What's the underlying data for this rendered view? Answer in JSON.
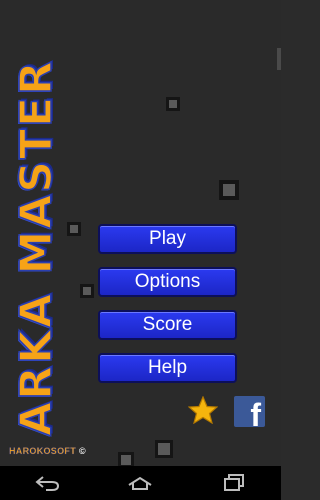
{
  "game": {
    "title": "ARKA MASTER",
    "credit": "HAROKOSOFT",
    "copyright": "©"
  },
  "menu": {
    "items": [
      {
        "label": "Play"
      },
      {
        "label": "Options"
      },
      {
        "label": "Score"
      },
      {
        "label": "Help"
      }
    ]
  },
  "social": {
    "rate_icon": "star-icon",
    "facebook_icon": "facebook-icon",
    "facebook_glyph": "f"
  },
  "navbar": {
    "icons": [
      "back-icon",
      "home-icon",
      "recent-apps-icon"
    ]
  },
  "colors": {
    "background": "#2a2a2a",
    "button": "#1f2bd6",
    "logo_orange": "#f6a317",
    "logo_blue": "#2a3fb0",
    "star": "#f5b50d",
    "facebook": "#3b5998"
  }
}
